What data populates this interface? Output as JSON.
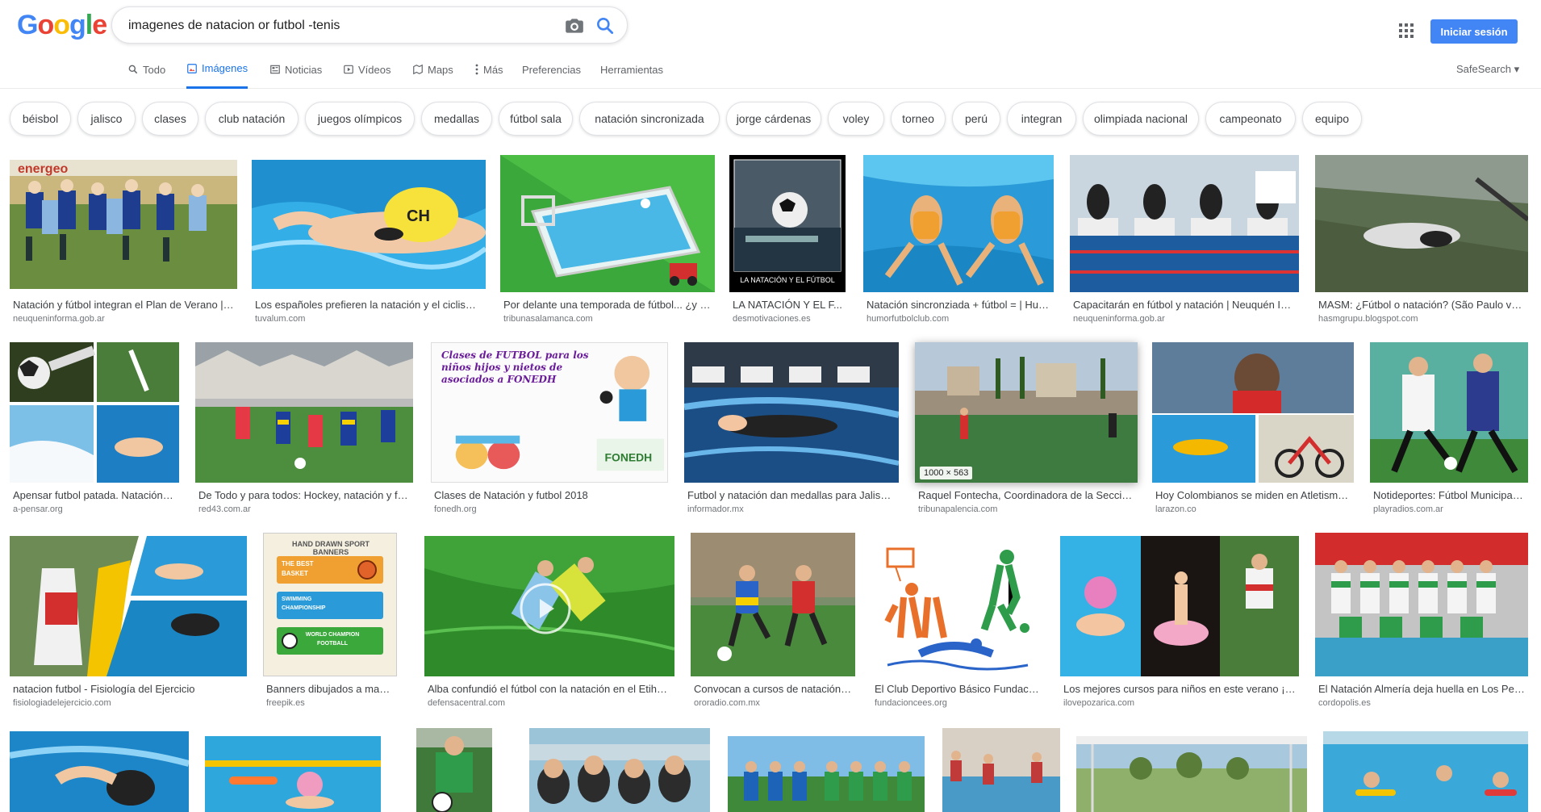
{
  "header": {
    "logo_text": "Google",
    "search_value": "imagenes de natacion or futbol -tenis",
    "signin_label": "Iniciar sesión"
  },
  "nav": {
    "tabs": [
      {
        "label": "Todo",
        "icon": "search-icon"
      },
      {
        "label": "Imágenes",
        "icon": "image-icon",
        "active": true
      },
      {
        "label": "Noticias",
        "icon": "news-icon"
      },
      {
        "label": "Vídeos",
        "icon": "video-icon"
      },
      {
        "label": "Maps",
        "icon": "map-icon"
      },
      {
        "label": "Más",
        "icon": "more-vert-icon"
      },
      {
        "label": "Preferencias"
      },
      {
        "label": "Herramientas"
      }
    ],
    "safesearch_label": "SafeSearch"
  },
  "chips": [
    "béisbol",
    "jalisco",
    "clases",
    "club natación",
    "juegos olímpicos",
    "medallas",
    "fútbol sala",
    "natación sincronizada",
    "jorge cárdenas",
    "voley",
    "torneo",
    "perú",
    "integran",
    "olimpiada nacional",
    "campeonato",
    "equipo"
  ],
  "results": [
    [
      {
        "caption": "Natación y fútbol integran el Plan de Verano | ...",
        "domain": "neuqueninforma.gob.ar"
      },
      {
        "caption": "Los españoles prefieren la natación y el ciclism...",
        "domain": "tuvalum.com"
      },
      {
        "caption": "Por delante una temporada de fútbol... ¿y n...",
        "domain": "tribunasalamanca.com"
      },
      {
        "caption": "LA NATACIÓN Y EL F...",
        "domain": "desmotivaciones.es"
      },
      {
        "caption": "Natación sincronziada + fútbol = | Hum...",
        "domain": "humorfutbolclub.com"
      },
      {
        "caption": "Capacitarán en fútbol y natación | Neuquén Inf...",
        "domain": "neuqueninforma.gob.ar"
      },
      {
        "caption": "MASM: ¿Fútbol o natación? (São Paulo vs ...",
        "domain": "hasmgrupu.blogspot.com"
      }
    ],
    [
      {
        "caption": "Apensar futbol patada. Natación. ...",
        "domain": "a-pensar.org"
      },
      {
        "caption": "De Todo y para todos: Hockey, natación y fút...",
        "domain": "red43.com.ar"
      },
      {
        "caption": "Clases de Natación y futbol 2018",
        "domain": "fonedh.org"
      },
      {
        "caption": "Futbol y natación dan medallas para Jalisco...",
        "domain": "informador.mx"
      },
      {
        "caption": "Raquel Fontecha, Coordinadora de la Sección...",
        "domain": "tribunapalencia.com",
        "badge": "1000 × 563"
      },
      {
        "caption": "Hoy Colombianos se miden en Atletismo,...",
        "domain": "larazon.co"
      },
      {
        "caption": "Notideportes: Fútbol Municipal,...",
        "domain": "playradios.com.ar"
      }
    ],
    [
      {
        "caption": "natacion futbol - Fisiología del Ejercicio",
        "domain": "fisiologiadelejercicio.com"
      },
      {
        "caption": "Banners dibujados a mano d...",
        "domain": "freepik.es"
      },
      {
        "caption": "Alba confundió el fútbol con la natación en el Etihad...",
        "domain": "defensacentral.com"
      },
      {
        "caption": "Convocan a cursos de natación y...",
        "domain": "ororadio.com.mx"
      },
      {
        "caption": "El Club Deportivo Básico Fundació...",
        "domain": "fundacioncees.org"
      },
      {
        "caption": "Los mejores cursos para niños en este verano ¡N...",
        "domain": "ilovepozarica.com"
      },
      {
        "caption": "El Natación Almería deja huella en Los Ped...",
        "domain": "cordopolis.es"
      }
    ]
  ],
  "thumb_texts": {
    "desmotivaciones": "LA NATACIÓN Y EL FÚTBOL",
    "fonedh_title": "Clases de FUTBOL para los niños hijos y nietos de asociados a FONEDH",
    "fonedh_brand": "FONEDH",
    "freepik_header": "HAND DRAWN SPORT BANNERS",
    "freepik_b1": "THE BEST BASKET",
    "freepik_b2": "SWIMMING CHAMPIONSHIP",
    "freepik_b3": "WORLD CHAMPION FOOTBALL"
  },
  "colors": {
    "accent": "#1a73e8",
    "signin": "#4285f4",
    "pool_blue": "#2a9bd8",
    "grass_green": "#3f8a3a"
  }
}
